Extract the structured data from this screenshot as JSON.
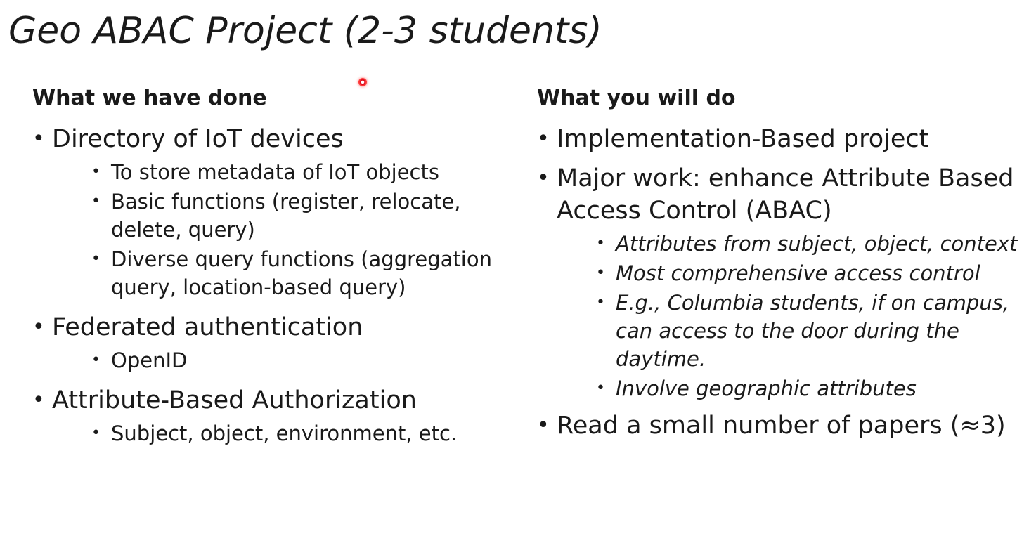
{
  "title": "Geo ABAC Project (2-3 students)",
  "left": {
    "heading": "What we have done",
    "items": [
      {
        "text": "Directory of IoT devices",
        "sub": [
          "To store metadata of IoT objects",
          "Basic functions (register, relocate, delete, query)",
          "Diverse query functions (aggregation query, location-based query)"
        ]
      },
      {
        "text": "Federated authentication",
        "sub": [
          "OpenID"
        ]
      },
      {
        "text": "Attribute-Based Authorization",
        "sub": [
          "Subject, object, environment, etc."
        ]
      }
    ]
  },
  "right": {
    "heading": "What you will do",
    "items": [
      {
        "text": "Implementation-Based project",
        "sub": []
      },
      {
        "text": "Major work: enhance Attribute Based Access Control (ABAC)",
        "sub": [
          "Attributes from subject, object, context",
          "Most comprehensive access control",
          "E.g., Columbia students, if on campus, can access to the door during the daytime.",
          "Involve geographic attributes"
        ]
      },
      {
        "text": "Read a small number of papers (≈3)",
        "sub": []
      }
    ]
  }
}
